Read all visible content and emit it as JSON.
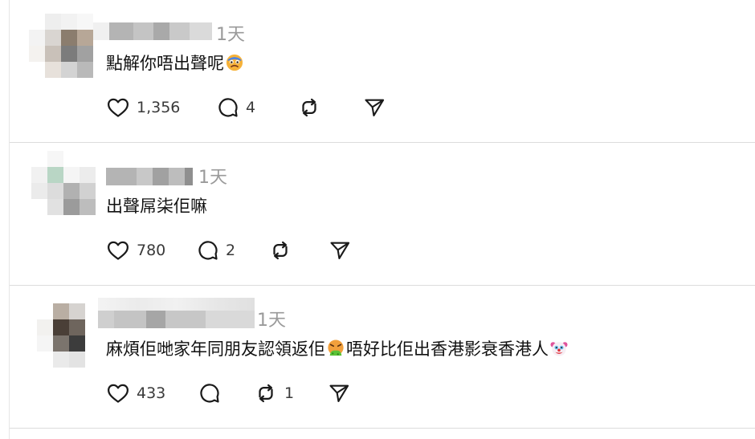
{
  "posts": [
    {
      "time": "1天",
      "text_parts": [
        "點解你唔出聲呢",
        ""
      ],
      "emojis": [
        "worried-face-emoji"
      ],
      "likes": "1,356",
      "replies": "4",
      "reposts": ""
    },
    {
      "time": "1天",
      "text_parts": [
        "出聲屌柒佢嘛"
      ],
      "emojis": [],
      "likes": "780",
      "replies": "2",
      "reposts": ""
    },
    {
      "time": "1天",
      "text_parts": [
        "麻煩佢哋家年同朋友認領返佢",
        " 唔好比佢出香港影衰香港人",
        ""
      ],
      "emojis": [
        "vomiting-face-emoji",
        "clown-face-emoji"
      ],
      "likes": "433",
      "replies": "",
      "reposts": "1"
    }
  ],
  "colors": {
    "icon": "#1a1a1a",
    "muted": "#9a9a9a",
    "divider": "#dcdcdc"
  }
}
